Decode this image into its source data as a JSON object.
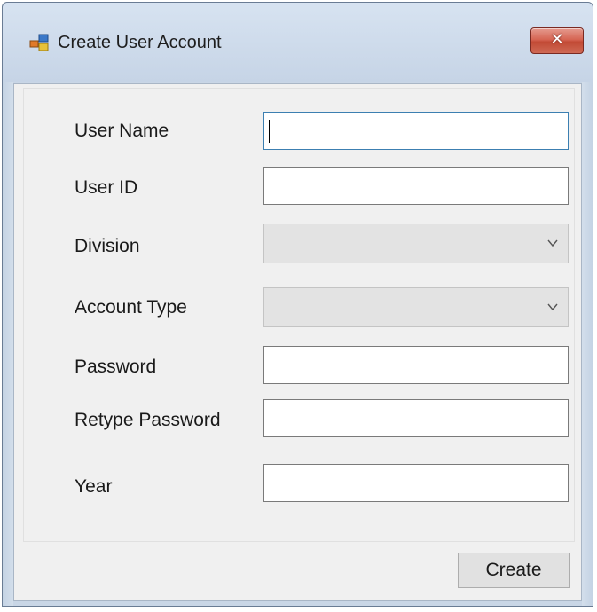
{
  "window": {
    "title": "Create User Account",
    "close_glyph": "✕",
    "icon": "form-app-icon"
  },
  "form": {
    "user_name": {
      "label": "User Name",
      "value": ""
    },
    "user_id": {
      "label": "User ID",
      "value": ""
    },
    "division": {
      "label": "Division",
      "value": ""
    },
    "account_type": {
      "label": "Account Type",
      "value": ""
    },
    "password": {
      "label": "Password",
      "value": ""
    },
    "retype_password": {
      "label": "Retype Password",
      "value": ""
    },
    "year": {
      "label": "Year",
      "value": ""
    }
  },
  "footer": {
    "create_label": "Create"
  },
  "colors": {
    "title_bar": "#c6d4e6",
    "close_button": "#c24a35",
    "dialog_background": "#f0f0f0",
    "focus_border": "#3c7fb1",
    "disabled_combo": "#e3e3e3"
  }
}
